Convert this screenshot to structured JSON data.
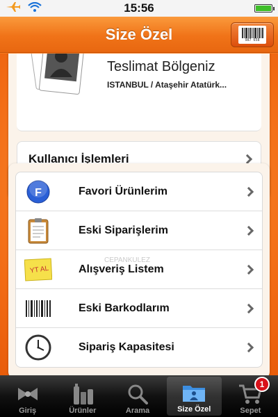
{
  "status_bar": {
    "time": "15:56",
    "icons": [
      "airplane-icon",
      "wifi-icon",
      "battery-icon"
    ]
  },
  "nav": {
    "title": "Size Özel",
    "barcode_number": "987 658",
    "barcode_icon": "barcode-icon"
  },
  "profile": {
    "delivery_title": "Teslimat Bölgeniz",
    "delivery_location": "ISTANBUL / Ataşehir Atatürk...",
    "user_section_label": "Kullanıcı İşlemleri"
  },
  "menu": {
    "items": [
      {
        "label": "Favori Ürünlerim",
        "icon": "favorites-f-icon"
      },
      {
        "label": "Eski Siparişlerim",
        "icon": "clipboard-icon"
      },
      {
        "label": "Alışveriş Listem",
        "icon": "sticky-note-icon",
        "note_text": "YT AL"
      },
      {
        "label": "Eski Barkodlarım",
        "icon": "barcode-icon"
      },
      {
        "label": "Sipariş Kapasitesi",
        "icon": "clock-icon"
      }
    ]
  },
  "watermark": "CEPANKULEZ",
  "tab_bar": {
    "tabs": [
      {
        "label": "Giriş",
        "icon": "bow-icon",
        "active": false
      },
      {
        "label": "Ürünler",
        "icon": "products-icon",
        "active": false
      },
      {
        "label": "Arama",
        "icon": "search-icon",
        "active": false
      },
      {
        "label": "Size Özel",
        "icon": "folder-icon",
        "active": true
      },
      {
        "label": "Sepet",
        "icon": "cart-icon",
        "active": false,
        "badge": "1"
      }
    ]
  },
  "colors": {
    "accent": "#f07318",
    "badge": "#d8111a",
    "favorite_icon": "#2a5fd6"
  }
}
